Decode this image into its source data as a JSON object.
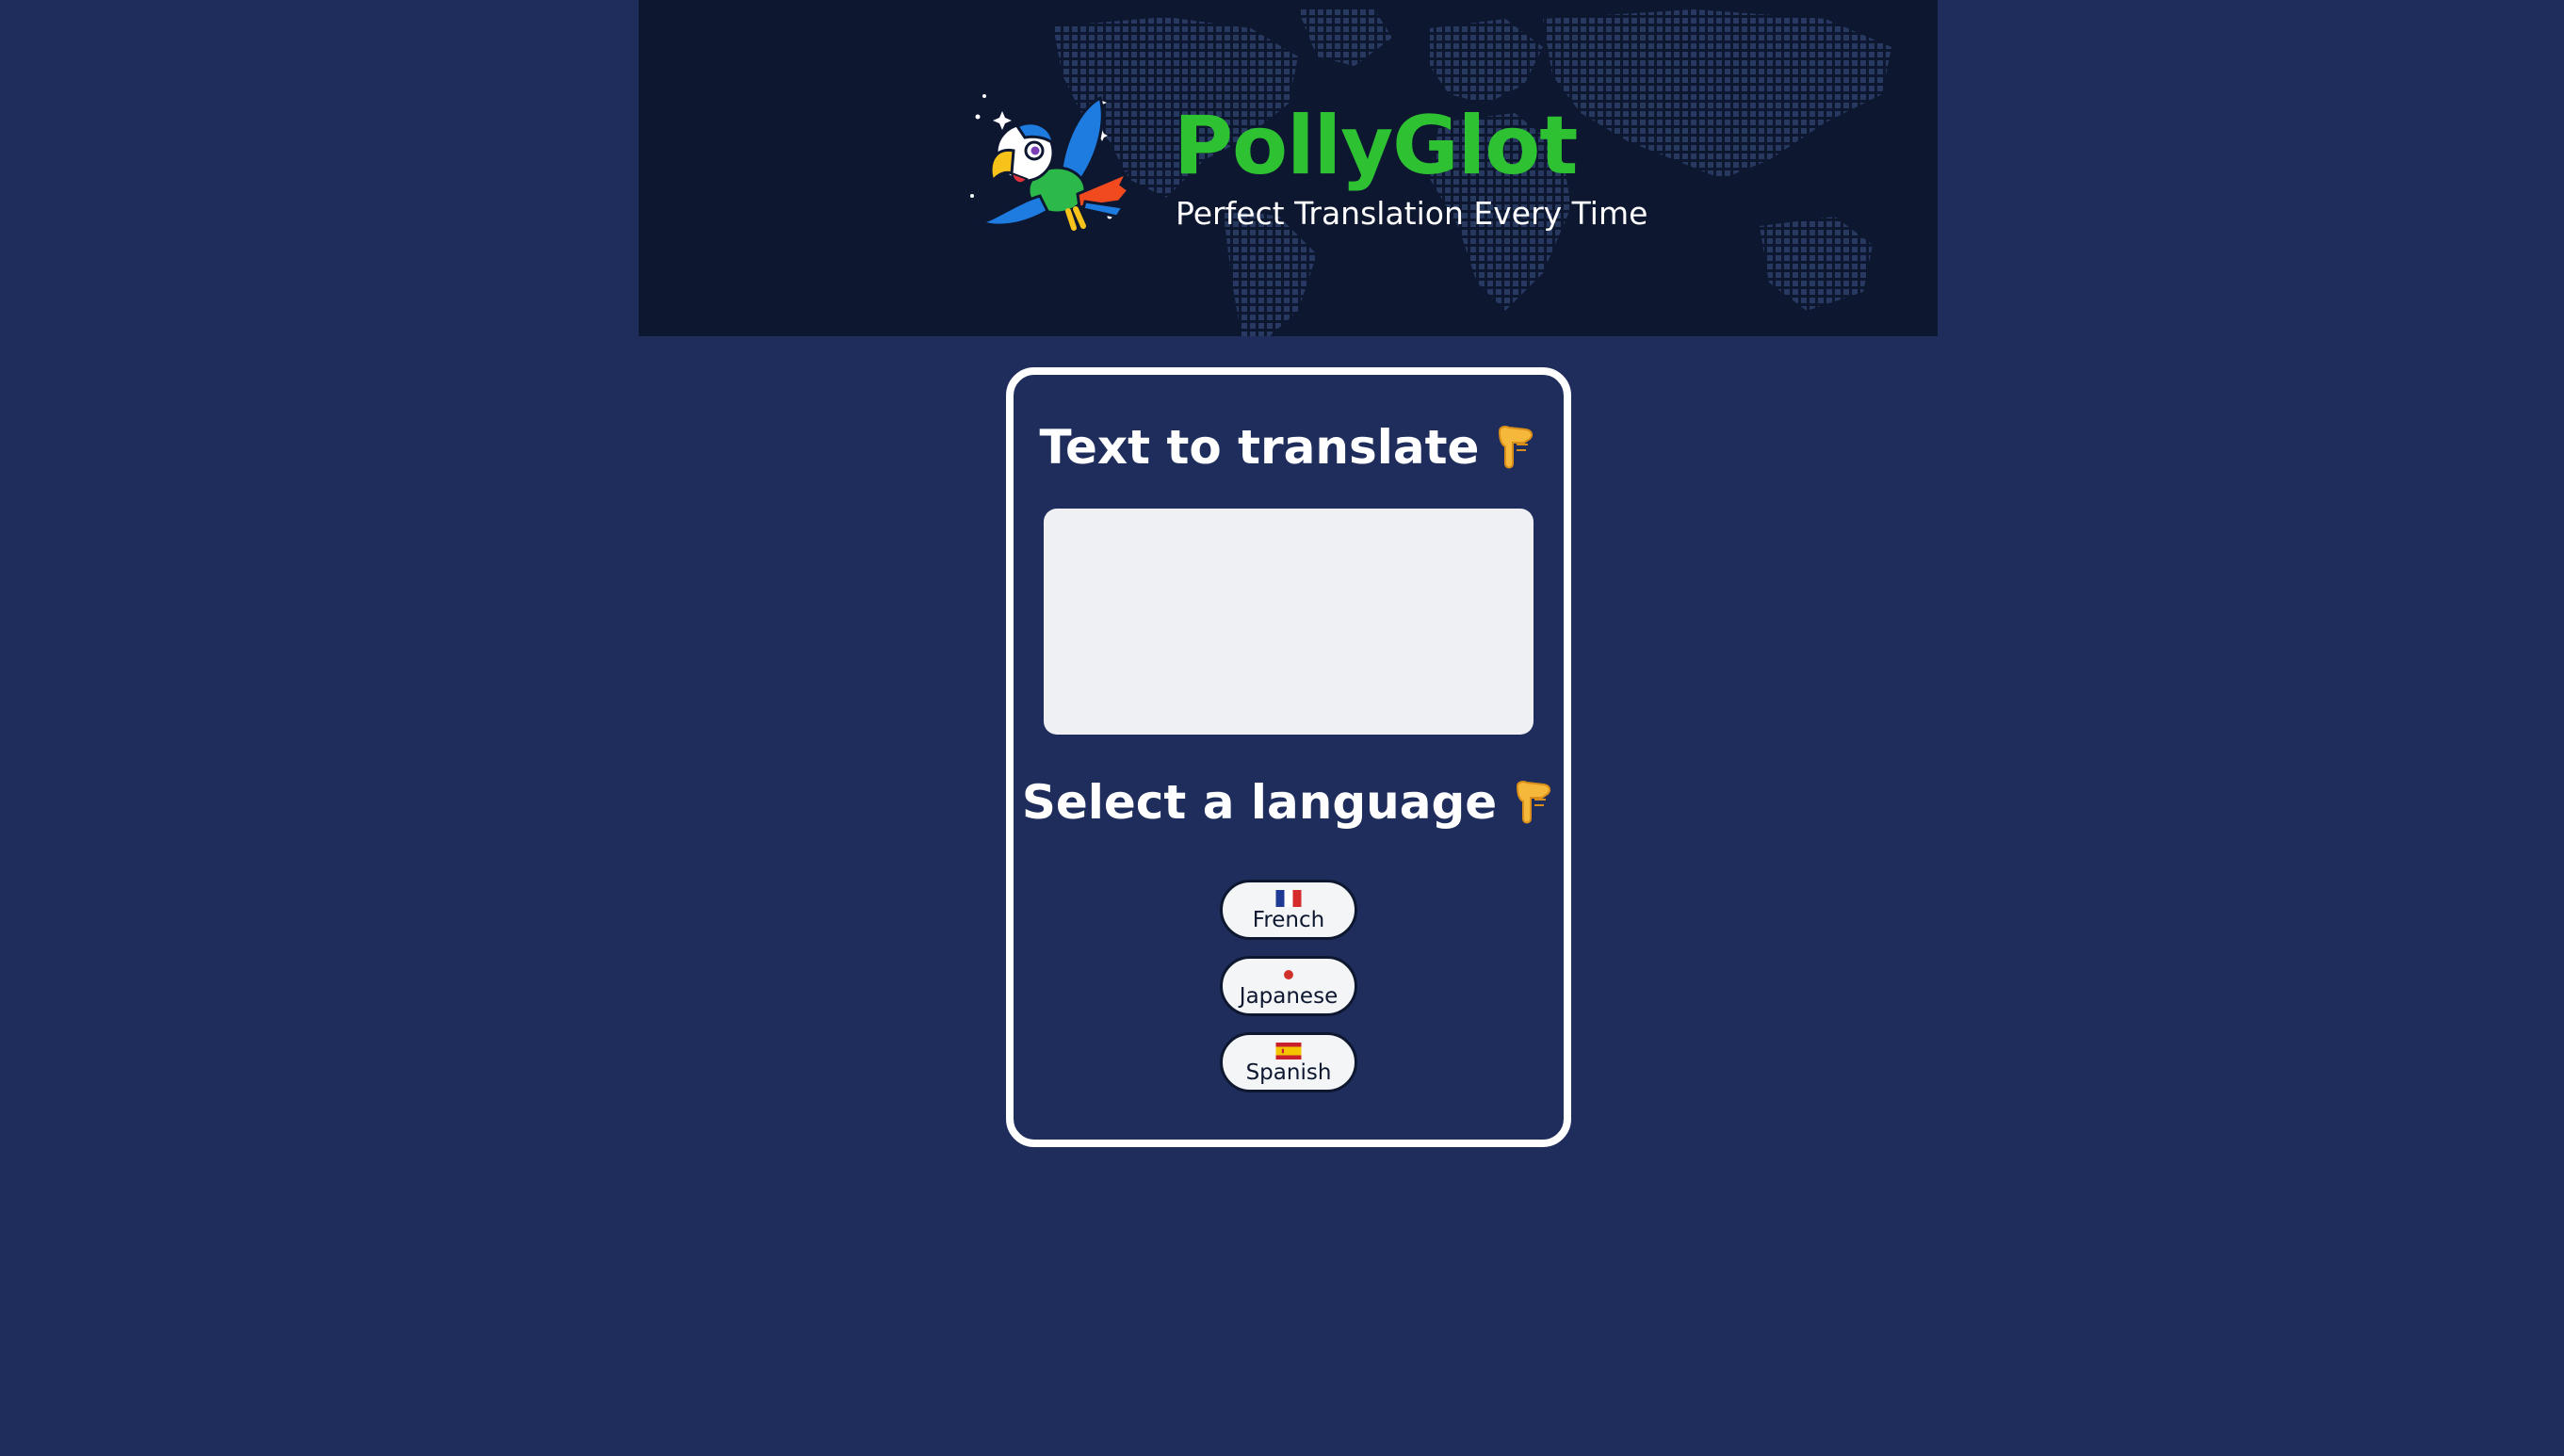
{
  "header": {
    "title": "PollyGlot",
    "tagline": "Perfect Translation Every Time",
    "logo_icon": "parrot-logo-icon",
    "background_icon": "world-map-icon"
  },
  "translate_card": {
    "text_heading": "Text to translate",
    "text_heading_icon": "pointing-down-hand-icon",
    "text_input_value": "",
    "language_heading": "Select a language",
    "language_heading_icon": "pointing-down-hand-icon",
    "languages": [
      {
        "label": "French",
        "flag_icon": "france-flag-icon"
      },
      {
        "label": "Japanese",
        "flag_icon": "japan-flag-icon"
      },
      {
        "label": "Spanish",
        "flag_icon": "spain-flag-icon"
      }
    ]
  },
  "colors": {
    "page_background": "#1e2d5c",
    "header_background": "#0d1730",
    "brand_green": "#2ec232",
    "card_border": "#ffffff",
    "input_background": "#eff0f3"
  }
}
